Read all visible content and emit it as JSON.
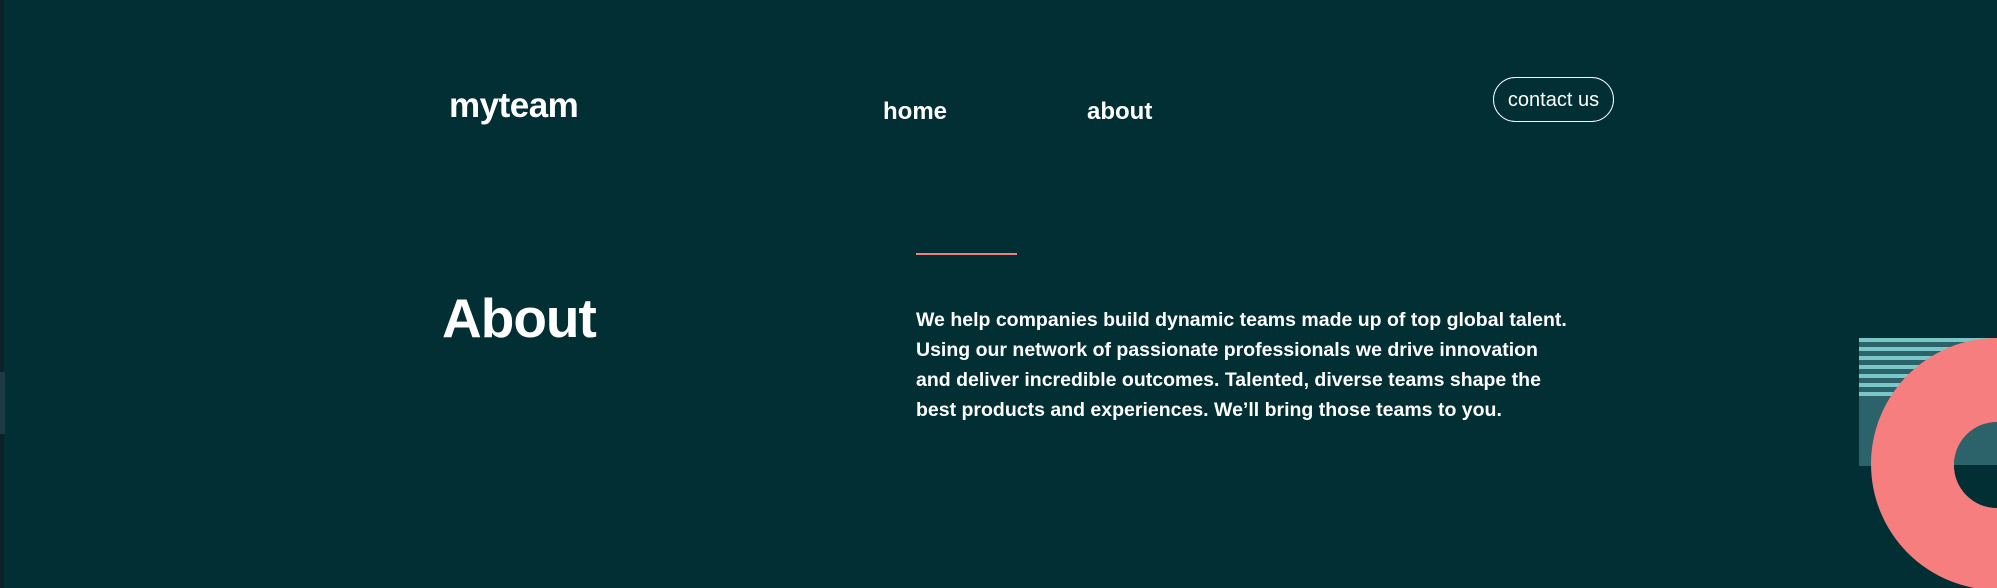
{
  "header": {
    "logo": "myteam",
    "nav": [
      {
        "label": "home"
      },
      {
        "label": "about"
      }
    ],
    "contact_button": "contact us"
  },
  "about": {
    "title": "About",
    "body": "We help companies build dynamic teams made up of top global talent. Using our network of passionate professionals we drive innovation and deliver incredible outcomes. Talented, diverse teams shape the best products and experiences. We’ll bring those teams to you."
  },
  "colors": {
    "background": "#012f34",
    "accent": "#f67e7e",
    "stripes": "#79c8c7",
    "teal": "#2c6269"
  }
}
